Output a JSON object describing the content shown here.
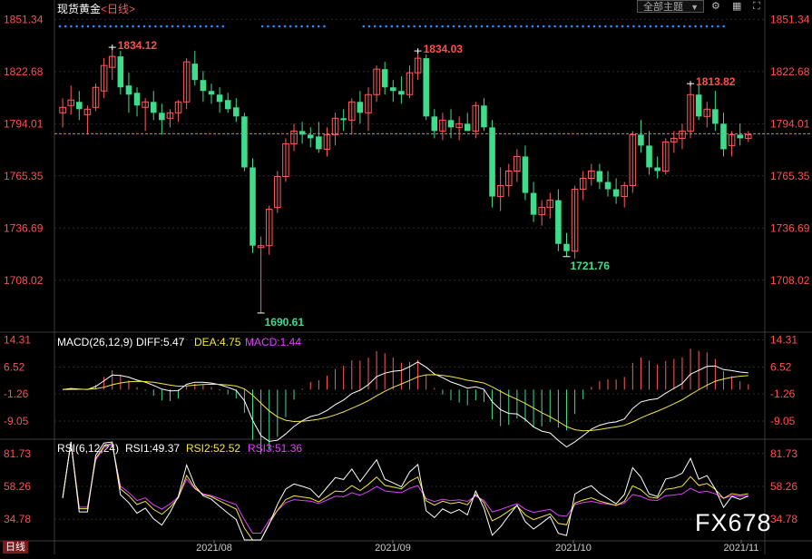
{
  "header": {
    "symbol": "现货黄金",
    "period": "<日线>",
    "theme_button": "全部主题",
    "theme_arrow": "▼"
  },
  "price_axis": {
    "labels": [
      "1851.34",
      "1822.68",
      "1794.01",
      "1765.35",
      "1736.69",
      "1708.02"
    ]
  },
  "macd_axis": {
    "labels": [
      "14.31",
      "6.52",
      "-1.26",
      "-9.05"
    ]
  },
  "rsi_axis": {
    "labels": [
      "81.73",
      "58.26",
      "34.78"
    ]
  },
  "date_axis": {
    "labels": [
      "2021/08",
      "2021/09",
      "2021/10",
      "2021/11"
    ]
  },
  "macd_legend": {
    "name": "MACD(26,12,9)",
    "diff": "DIFF:5.47",
    "dea": "DEA:4.75",
    "macd": "MACD:1.44"
  },
  "rsi_legend": {
    "name": "RSI(6,12,24)",
    "rsi1": "RSI1:49.37",
    "rsi2": "RSI2:52.52",
    "rsi3": "RSI3:51.36"
  },
  "annotations": {
    "high1": "1834.12",
    "high2": "1834.03",
    "high3": "1813.82",
    "low1": "1690.61",
    "low2": "1721.76"
  },
  "watermark": "FX678",
  "period_tag": "日线",
  "colors": {
    "up": "#ff5c5c",
    "down": "#3fdc8c",
    "axis_text": "#ff4f4f",
    "grid": "#2a2a2a",
    "white": "#ffffff",
    "yellow": "#f5e642",
    "magenta": "#e040fb",
    "dots": "#2f8cff",
    "dash": "#d98c2a",
    "low_label": "#3fdc8c"
  },
  "chart_data": {
    "type": "candlestick",
    "title": "现货黄金 <日线>",
    "y_range": [
      1680,
      1855
    ],
    "last_close": 1788.5,
    "ohlc": [
      [
        1800,
        1808,
        1792,
        1803
      ],
      [
        1804,
        1815,
        1799,
        1807
      ],
      [
        1806,
        1812,
        1796,
        1802
      ],
      [
        1799,
        1804,
        1788,
        1802
      ],
      [
        1803,
        1816,
        1801,
        1814
      ],
      [
        1812,
        1830,
        1808,
        1826
      ],
      [
        1825,
        1836,
        1818,
        1831
      ],
      [
        1831,
        1834,
        1810,
        1814
      ],
      [
        1815,
        1822,
        1800,
        1810
      ],
      [
        1811,
        1814,
        1798,
        1804
      ],
      [
        1803,
        1808,
        1790,
        1806
      ],
      [
        1806,
        1812,
        1796,
        1800
      ],
      [
        1800,
        1805,
        1788,
        1796
      ],
      [
        1797,
        1802,
        1792,
        1800
      ],
      [
        1800,
        1807,
        1795,
        1806
      ],
      [
        1806,
        1830,
        1802,
        1828
      ],
      [
        1827,
        1834,
        1815,
        1818
      ],
      [
        1818,
        1823,
        1806,
        1812
      ],
      [
        1812,
        1816,
        1805,
        1810
      ],
      [
        1810,
        1814,
        1800,
        1806
      ],
      [
        1807,
        1811,
        1800,
        1802
      ],
      [
        1803,
        1808,
        1795,
        1798
      ],
      [
        1798,
        1800,
        1768,
        1770
      ],
      [
        1770,
        1775,
        1723,
        1727
      ],
      [
        1726,
        1732,
        1690,
        1727
      ],
      [
        1727,
        1749,
        1722,
        1747
      ],
      [
        1748,
        1768,
        1745,
        1765
      ],
      [
        1765,
        1786,
        1762,
        1783
      ],
      [
        1783,
        1794,
        1779,
        1790
      ],
      [
        1790,
        1795,
        1783,
        1788
      ],
      [
        1788,
        1792,
        1781,
        1786
      ],
      [
        1787,
        1795,
        1778,
        1780
      ],
      [
        1780,
        1792,
        1776,
        1788
      ],
      [
        1788,
        1800,
        1782,
        1797
      ],
      [
        1797,
        1802,
        1790,
        1796
      ],
      [
        1796,
        1808,
        1788,
        1806
      ],
      [
        1806,
        1812,
        1794,
        1800
      ],
      [
        1800,
        1814,
        1790,
        1810
      ],
      [
        1810,
        1826,
        1806,
        1824
      ],
      [
        1824,
        1828,
        1810,
        1814
      ],
      [
        1814,
        1818,
        1806,
        1812
      ],
      [
        1812,
        1820,
        1805,
        1810
      ],
      [
        1810,
        1826,
        1808,
        1822
      ],
      [
        1822,
        1834,
        1818,
        1830
      ],
      [
        1830,
        1832,
        1796,
        1798
      ],
      [
        1798,
        1802,
        1786,
        1790
      ],
      [
        1790,
        1800,
        1785,
        1796
      ],
      [
        1796,
        1802,
        1786,
        1792
      ],
      [
        1792,
        1798,
        1785,
        1794
      ],
      [
        1794,
        1800,
        1790,
        1790
      ],
      [
        1790,
        1806,
        1786,
        1804
      ],
      [
        1804,
        1808,
        1790,
        1792
      ],
      [
        1792,
        1796,
        1748,
        1754
      ],
      [
        1754,
        1770,
        1746,
        1760
      ],
      [
        1760,
        1772,
        1754,
        1768
      ],
      [
        1768,
        1780,
        1762,
        1776
      ],
      [
        1776,
        1782,
        1752,
        1756
      ],
      [
        1756,
        1762,
        1740,
        1744
      ],
      [
        1744,
        1752,
        1738,
        1748
      ],
      [
        1748,
        1756,
        1742,
        1752
      ],
      [
        1752,
        1758,
        1724,
        1728
      ],
      [
        1728,
        1734,
        1721,
        1724
      ],
      [
        1724,
        1760,
        1720,
        1758
      ],
      [
        1758,
        1768,
        1752,
        1764
      ],
      [
        1764,
        1772,
        1760,
        1768
      ],
      [
        1768,
        1772,
        1758,
        1762
      ],
      [
        1762,
        1768,
        1754,
        1758
      ],
      [
        1758,
        1764,
        1750,
        1754
      ],
      [
        1754,
        1762,
        1748,
        1760
      ],
      [
        1760,
        1790,
        1756,
        1788
      ],
      [
        1788,
        1796,
        1778,
        1782
      ],
      [
        1782,
        1790,
        1766,
        1770
      ],
      [
        1770,
        1776,
        1764,
        1768
      ],
      [
        1768,
        1786,
        1766,
        1784
      ],
      [
        1784,
        1790,
        1778,
        1786
      ],
      [
        1786,
        1794,
        1780,
        1790
      ],
      [
        1790,
        1816,
        1786,
        1810
      ],
      [
        1810,
        1816,
        1796,
        1798
      ],
      [
        1798,
        1806,
        1792,
        1802
      ],
      [
        1802,
        1812,
        1790,
        1794
      ],
      [
        1794,
        1800,
        1776,
        1780
      ],
      [
        1782,
        1790,
        1776,
        1788
      ],
      [
        1788,
        1794,
        1782,
        1786
      ],
      [
        1786,
        1790,
        1784,
        1788
      ]
    ],
    "high_labels": [
      "1834.12",
      "1834.03",
      "1813.82"
    ],
    "low_labels": [
      "1690.61",
      "1721.76"
    ],
    "x_labels": [
      "2021/08",
      "2021/09",
      "2021/10",
      "2021/11"
    ],
    "macd": {
      "name": "MACD(26,12,9)",
      "diff": 5.47,
      "dea": 4.75,
      "macd": 1.44,
      "range": [
        -14,
        16
      ]
    },
    "rsi": {
      "name": "RSI(6,12,24)",
      "rsi1": 49.37,
      "rsi2": 52.52,
      "rsi3": 51.36,
      "range": [
        20,
        90
      ]
    }
  }
}
